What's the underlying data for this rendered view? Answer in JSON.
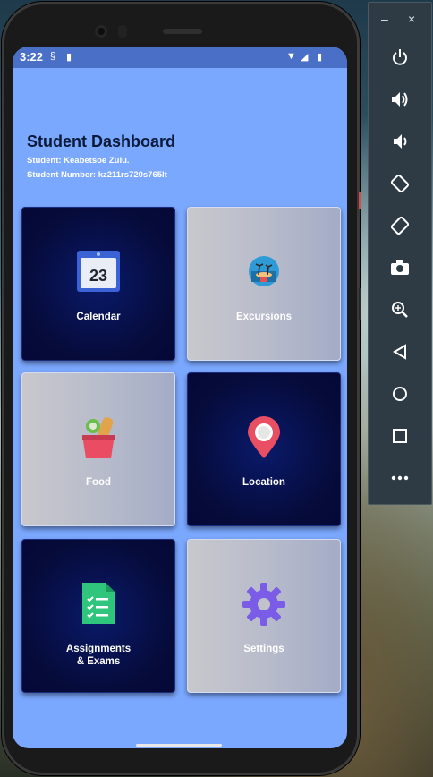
{
  "status_bar": {
    "time": "3:22"
  },
  "header": {
    "title": "Student Dashboard",
    "student": "Student: Keabetsoe Zulu.",
    "student_number": "Student Number: kz211rs720s765lt"
  },
  "tiles": [
    {
      "label": "Calendar",
      "icon": "calendar-icon",
      "calendar_day": "23",
      "style": "dark"
    },
    {
      "label": "Excursions",
      "icon": "island-icon",
      "style": "light"
    },
    {
      "label": "Food",
      "icon": "grocery-basket-icon",
      "style": "light"
    },
    {
      "label": "Location",
      "icon": "location-pin-icon",
      "style": "dark"
    },
    {
      "label_line1": "Assignments",
      "label_line2": "& Exams",
      "icon": "checklist-document-icon",
      "style": "dark"
    },
    {
      "label": "Settings",
      "icon": "gear-icon",
      "style": "light"
    }
  ],
  "emulator_toolbar": {
    "minimize": "–",
    "close": "×",
    "buttons": [
      "power-icon",
      "volume-up-icon",
      "volume-down-icon",
      "rotate-left-icon",
      "rotate-right-icon",
      "camera-icon",
      "zoom-icon",
      "back-icon",
      "home-icon",
      "overview-icon",
      "more-icon"
    ]
  },
  "colors": {
    "screen_bg": "#7ba8ff",
    "status_bar_bg": "#4a6fc7",
    "tile_dark": "#060b3a",
    "tile_light": "#c0c3cc",
    "title_color": "#0b1a3a"
  }
}
